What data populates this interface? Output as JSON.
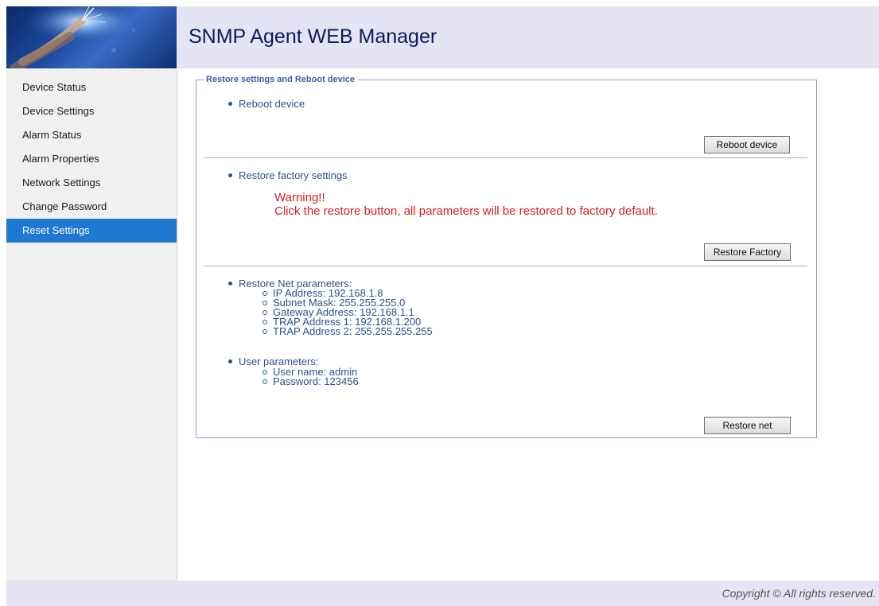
{
  "header": {
    "title": "SNMP Agent WEB Manager",
    "logo_icon": "fiber-optic-logo-icon"
  },
  "sidebar": {
    "items": [
      {
        "label": "Device Status",
        "active": false
      },
      {
        "label": "Device Settings",
        "active": false
      },
      {
        "label": "Alarm Status",
        "active": false
      },
      {
        "label": "Alarm Properties",
        "active": false
      },
      {
        "label": "Network Settings",
        "active": false
      },
      {
        "label": "Change Password",
        "active": false
      },
      {
        "label": "Reset Settings",
        "active": true
      }
    ]
  },
  "main": {
    "legend": "Restore settings and Reboot device",
    "reboot": {
      "bullet": "Reboot device",
      "button_label": "Reboot device"
    },
    "factory": {
      "bullet": "Restore factory settings",
      "warning_title": "Warning!!",
      "warning_text": "Click the restore button, all parameters will be restored to factory default.",
      "button_label": "Restore Factory"
    },
    "net": {
      "bullet": "Restore Net parameters:",
      "params": [
        "IP Address: 192.168.1.8",
        "Subnet Mask: 255.255.255.0",
        "Gateway Address: 192.168.1.1",
        "TRAP Address 1: 192.168.1.200",
        "TRAP Address 2: 255.255.255.255"
      ],
      "user_bullet": "User parameters:",
      "user_params": [
        "User name: admin",
        "Password: 123456"
      ],
      "button_label": "Restore net"
    }
  },
  "footer": {
    "copyright": "Copyright © All rights reserved."
  },
  "colors": {
    "header_bg": "#e4e4f4",
    "accent": "#1f78d1",
    "warning": "#d42020",
    "link_text": "#2c4f8f"
  }
}
